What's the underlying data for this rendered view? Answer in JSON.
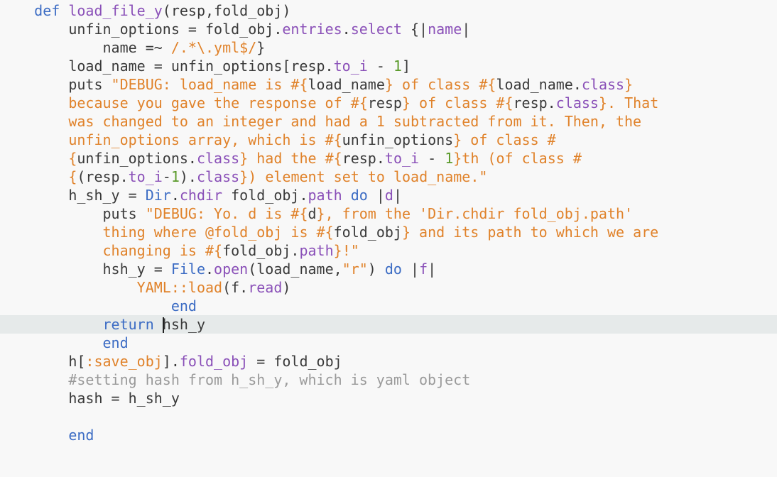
{
  "editor": {
    "colors": {
      "background": "#f8f8f8",
      "current_line": "#e6eaea",
      "keyword": "#3c6cc4",
      "method": "#8a50b8",
      "string": "#e0822a",
      "number": "#5a9a2a",
      "comment": "#9a9a9a",
      "text": "#3a3a3a"
    },
    "current_line_index": 17,
    "lines": [
      [
        [
          "    ",
          "plain"
        ],
        [
          "def",
          "kw"
        ],
        [
          " ",
          "plain"
        ],
        [
          "load_file_y",
          "fn"
        ],
        [
          "(resp,fold_obj)",
          "plain"
        ]
      ],
      [
        [
          "        unfin_options = fold_obj.",
          "plain"
        ],
        [
          "entries",
          "meth"
        ],
        [
          ".",
          "plain"
        ],
        [
          "select",
          "meth"
        ],
        [
          " {|",
          "plain"
        ],
        [
          "name",
          "meth"
        ],
        [
          "|",
          "plain"
        ]
      ],
      [
        [
          "            name =~ ",
          "plain"
        ],
        [
          "/.*\\.yml$/",
          "str"
        ],
        [
          "}",
          "plain"
        ]
      ],
      [
        [
          "        load_name = unfin_options[resp.",
          "plain"
        ],
        [
          "to_i",
          "meth"
        ],
        [
          " - ",
          "plain"
        ],
        [
          "1",
          "num"
        ],
        [
          "]",
          "plain"
        ]
      ],
      [
        [
          "        puts ",
          "plain"
        ],
        [
          "\"DEBUG: load_name is ",
          "str"
        ],
        [
          "#{",
          "str"
        ],
        [
          "load_name",
          "plain"
        ],
        [
          "}",
          "str"
        ],
        [
          " of class ",
          "str"
        ],
        [
          "#{",
          "str"
        ],
        [
          "load_name.",
          "plain"
        ],
        [
          "class",
          "meth"
        ],
        [
          "}",
          "str"
        ]
      ],
      [
        [
          "        ",
          "plain"
        ],
        [
          "because you gave the response of ",
          "str"
        ],
        [
          "#{",
          "str"
        ],
        [
          "resp",
          "plain"
        ],
        [
          "}",
          "str"
        ],
        [
          " of class ",
          "str"
        ],
        [
          "#{",
          "str"
        ],
        [
          "resp.",
          "plain"
        ],
        [
          "class",
          "meth"
        ],
        [
          "}",
          "str"
        ],
        [
          ". That",
          "str"
        ]
      ],
      [
        [
          "        ",
          "plain"
        ],
        [
          "was changed to an integer and had a 1 subtracted from it. Then, the",
          "str"
        ]
      ],
      [
        [
          "        ",
          "plain"
        ],
        [
          "unfin_options array, which is ",
          "str"
        ],
        [
          "#{",
          "str"
        ],
        [
          "unfin_options",
          "plain"
        ],
        [
          "}",
          "str"
        ],
        [
          " of class #",
          "str"
        ]
      ],
      [
        [
          "        ",
          "plain"
        ],
        [
          "{",
          "str"
        ],
        [
          "unfin_options.",
          "plain"
        ],
        [
          "class",
          "meth"
        ],
        [
          "}",
          "str"
        ],
        [
          " had the ",
          "str"
        ],
        [
          "#{",
          "str"
        ],
        [
          "resp.",
          "plain"
        ],
        [
          "to_i",
          "meth"
        ],
        [
          " - ",
          "plain"
        ],
        [
          "1",
          "num"
        ],
        [
          "}",
          "str"
        ],
        [
          "th (of class #",
          "str"
        ]
      ],
      [
        [
          "        ",
          "plain"
        ],
        [
          "{",
          "str"
        ],
        [
          "(resp.",
          "plain"
        ],
        [
          "to_i",
          "meth"
        ],
        [
          "-",
          "plain"
        ],
        [
          "1",
          "num"
        ],
        [
          ").",
          "plain"
        ],
        [
          "class",
          "meth"
        ],
        [
          "}",
          "str"
        ],
        [
          ") element set to load_name.\"",
          "str"
        ]
      ],
      [
        [
          "        h_sh_y = ",
          "plain"
        ],
        [
          "Dir",
          "cls"
        ],
        [
          ".",
          "plain"
        ],
        [
          "chdir",
          "meth"
        ],
        [
          " fold_obj.",
          "plain"
        ],
        [
          "path",
          "meth"
        ],
        [
          " ",
          "plain"
        ],
        [
          "do",
          "kw"
        ],
        [
          " |",
          "plain"
        ],
        [
          "d",
          "meth"
        ],
        [
          "|",
          "plain"
        ]
      ],
      [
        [
          "            puts ",
          "plain"
        ],
        [
          "\"DEBUG: Yo. d is ",
          "str"
        ],
        [
          "#{",
          "str"
        ],
        [
          "d",
          "plain"
        ],
        [
          "}",
          "str"
        ],
        [
          ", from the 'Dir.chdir fold_obj.path'",
          "str"
        ]
      ],
      [
        [
          "            ",
          "plain"
        ],
        [
          "thing where @fold_obj is ",
          "str"
        ],
        [
          "#{",
          "str"
        ],
        [
          "fold_obj",
          "plain"
        ],
        [
          "}",
          "str"
        ],
        [
          " and its path to which we are",
          "str"
        ]
      ],
      [
        [
          "            ",
          "plain"
        ],
        [
          "changing is ",
          "str"
        ],
        [
          "#{",
          "str"
        ],
        [
          "fold_obj.",
          "plain"
        ],
        [
          "path",
          "meth"
        ],
        [
          "}",
          "str"
        ],
        [
          "!\"",
          "str"
        ]
      ],
      [
        [
          "            hsh_y = ",
          "plain"
        ],
        [
          "File",
          "cls"
        ],
        [
          ".",
          "plain"
        ],
        [
          "open",
          "meth"
        ],
        [
          "(load_name,",
          "plain"
        ],
        [
          "\"r\"",
          "str"
        ],
        [
          ") ",
          "plain"
        ],
        [
          "do",
          "kw"
        ],
        [
          " |",
          "plain"
        ],
        [
          "f",
          "meth"
        ],
        [
          "|",
          "plain"
        ]
      ],
      [
        [
          "                ",
          "plain"
        ],
        [
          "YAML::load",
          "sym"
        ],
        [
          "(f.",
          "plain"
        ],
        [
          "read",
          "meth"
        ],
        [
          ")",
          "plain"
        ]
      ],
      [
        [
          "                    ",
          "plain"
        ],
        [
          "end",
          "kw"
        ]
      ],
      [
        [
          "            ",
          "plain"
        ],
        [
          "return",
          "kw"
        ],
        [
          " ",
          "plain"
        ],
        [
          "|CURSOR|",
          "cursor"
        ],
        [
          "hsh_y",
          "plain"
        ]
      ],
      [
        [
          "            ",
          "plain"
        ],
        [
          "end",
          "kw"
        ]
      ],
      [
        [
          "        h[",
          "plain"
        ],
        [
          ":save_obj",
          "sym"
        ],
        [
          "].",
          "plain"
        ],
        [
          "fold_obj",
          "meth"
        ],
        [
          " = fold_obj",
          "plain"
        ]
      ],
      [
        [
          "        ",
          "plain"
        ],
        [
          "#setting hash from h_sh_y, which is yaml object",
          "cmt"
        ]
      ],
      [
        [
          "        hash = h_sh_y",
          "plain"
        ]
      ],
      [
        [
          "",
          "plain"
        ]
      ],
      [
        [
          "        ",
          "plain"
        ],
        [
          "end",
          "kw"
        ]
      ]
    ]
  }
}
